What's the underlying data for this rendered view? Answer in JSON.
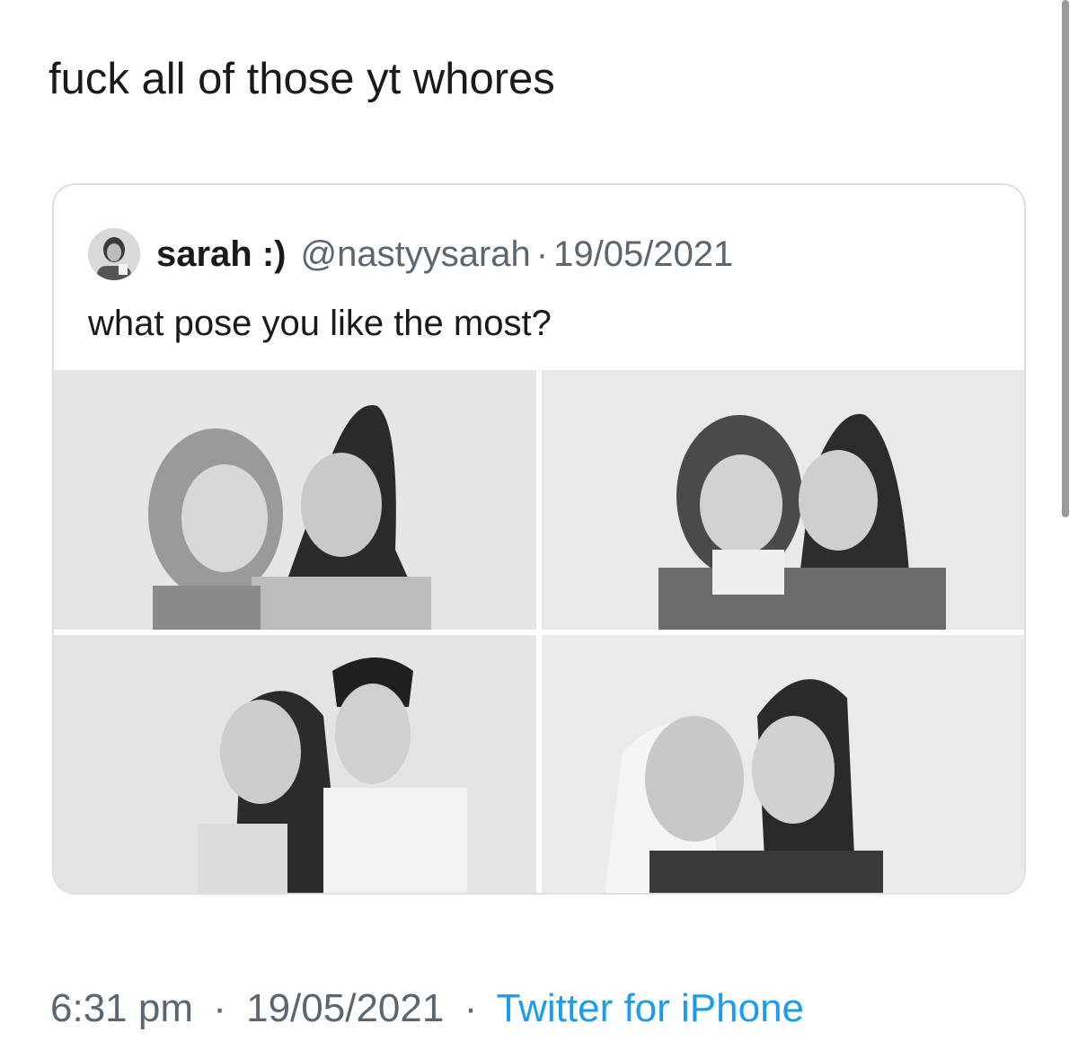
{
  "tweet": {
    "text": "fuck all of those yt whores",
    "time": "6:31 pm",
    "date": "19/05/2021",
    "source": "Twitter for iPhone",
    "separator": "·"
  },
  "quoted_tweet": {
    "display_name": "sarah :)",
    "handle": "@nastyysarah",
    "separator": "·",
    "date": "19/05/2021",
    "text": "what pose you like the most?",
    "media_count": 4
  },
  "colors": {
    "text": "#1a1a1a",
    "secondary": "#5b6670",
    "link": "#1d9bf0",
    "border": "#dcdfe3"
  }
}
